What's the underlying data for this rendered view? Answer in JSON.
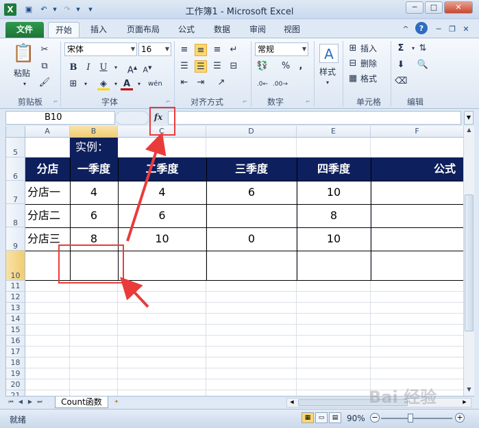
{
  "window": {
    "title": "工作簿1 - Microsoft Excel",
    "minimize": "─",
    "maximize": "□",
    "close": "✕"
  },
  "tabs": [
    {
      "label": "文件"
    },
    {
      "label": "开始"
    },
    {
      "label": "插入"
    },
    {
      "label": "页面布局"
    },
    {
      "label": "公式"
    },
    {
      "label": "数据"
    },
    {
      "label": "审阅"
    },
    {
      "label": "视图"
    }
  ],
  "ribbon": {
    "clipboard": {
      "paste": "粘贴",
      "label": "剪贴板"
    },
    "font": {
      "name": "宋体",
      "size": "16",
      "label": "字体",
      "bold": "B",
      "italic": "I",
      "underline": "U"
    },
    "alignment": {
      "label": "对齐方式"
    },
    "number": {
      "format": "常规",
      "label": "数字",
      "percent": "%",
      "comma": ","
    },
    "styles": {
      "styles": "样式"
    },
    "cells": {
      "insert": "插入",
      "delete": "删除",
      "format": "格式",
      "label": "单元格"
    },
    "editing": {
      "label": "编辑",
      "sum": "Σ"
    }
  },
  "formula_bar": {
    "name_box": "B10",
    "fx": "fx",
    "formula": ""
  },
  "columns": [
    "A",
    "B",
    "C",
    "D",
    "E",
    "F"
  ],
  "rows": [
    "5",
    "6",
    "7",
    "8",
    "9",
    "10",
    "11",
    "12",
    "13",
    "14",
    "15",
    "16",
    "17",
    "18",
    "19",
    "20",
    "21"
  ],
  "sheet": {
    "example_label": "实例：",
    "headers": [
      "分店",
      "一季度",
      "二季度",
      "三季度",
      "四季度",
      "公式"
    ],
    "data": [
      [
        "分店一",
        "4",
        "4",
        "6",
        "10",
        ""
      ],
      [
        "分店二",
        "6",
        "6",
        "",
        "8",
        ""
      ],
      [
        "分店三",
        "8",
        "10",
        "0",
        "10",
        ""
      ]
    ]
  },
  "sheet_tabs": {
    "active": "Count函数"
  },
  "status": {
    "ready": "就绪",
    "zoom": "90%"
  },
  "watermark": "Bai 经验",
  "colors": {
    "header_fill": "#0d1f5c",
    "annotation": "#ea3b3b",
    "file_tab": "#1d7236"
  }
}
